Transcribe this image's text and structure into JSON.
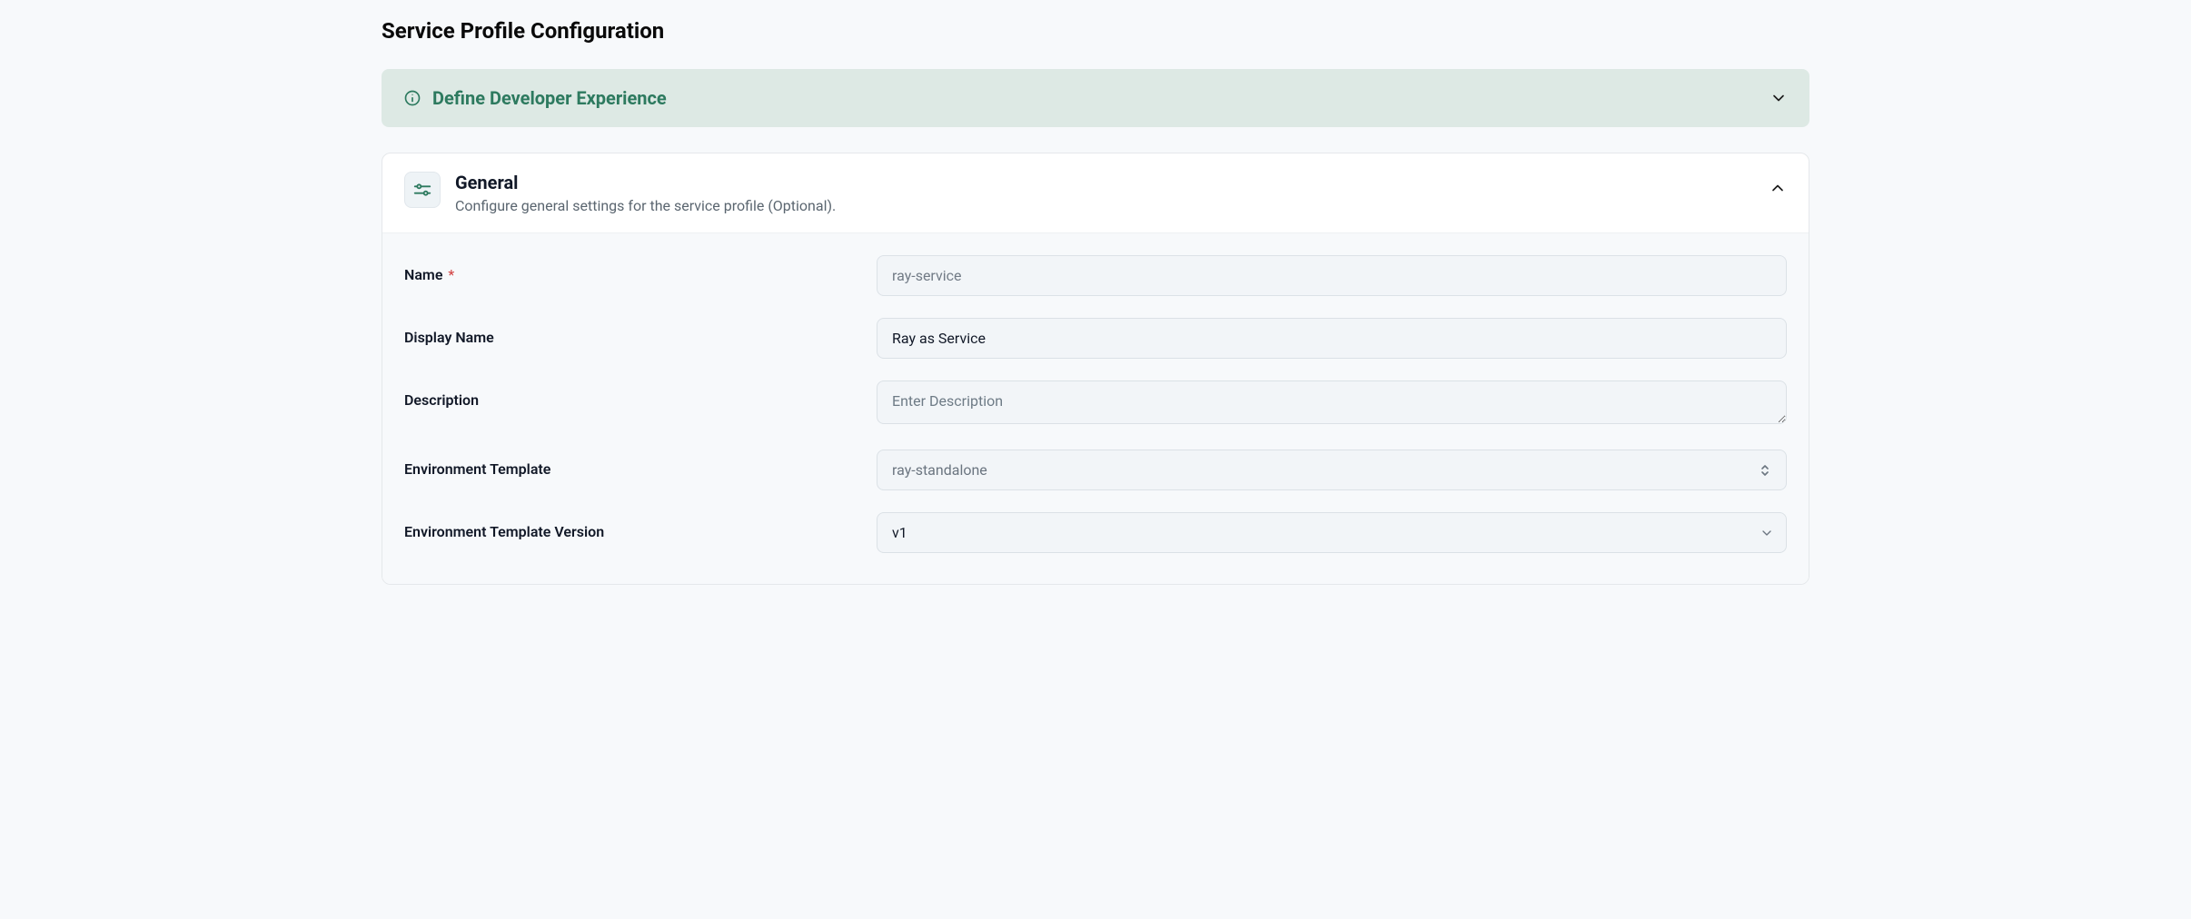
{
  "page_title": "Service Profile Configuration",
  "banner": {
    "title": "Define Developer Experience"
  },
  "general_section": {
    "title": "General",
    "subtitle": "Configure general settings for the service profile (Optional).",
    "fields": {
      "name": {
        "label": "Name",
        "value": "ray-service",
        "required_mark": "*"
      },
      "display_name": {
        "label": "Display Name",
        "value": "Ray as Service"
      },
      "description": {
        "label": "Description",
        "placeholder": "Enter Description",
        "value": ""
      },
      "env_template": {
        "label": "Environment Template",
        "value": "ray-standalone"
      },
      "env_template_version": {
        "label": "Environment Template Version",
        "value": "v1"
      }
    }
  }
}
